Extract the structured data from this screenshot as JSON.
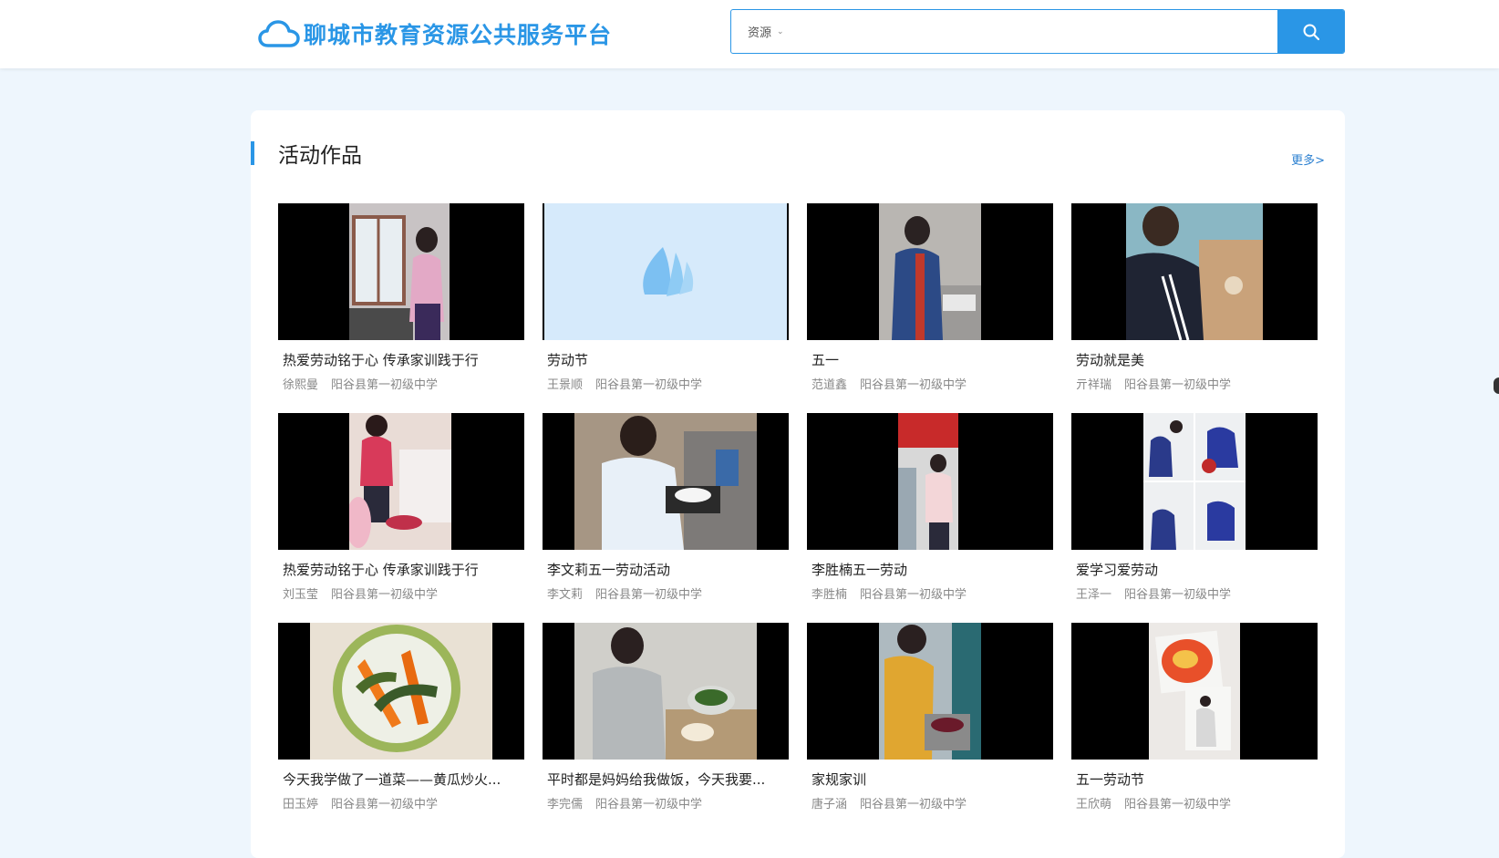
{
  "site": {
    "title": "聊城市教育资源公共服务平台",
    "brand_color": "#2a96e6"
  },
  "search": {
    "type_label": "资源",
    "placeholder": "",
    "icon": "search-icon"
  },
  "section": {
    "title": "活动作品",
    "more_label": "更多>"
  },
  "works": [
    {
      "title": "热爱劳动铭于心 传承家训践于行",
      "author": "徐熙曼",
      "school": "阳谷县第一初级中学",
      "thumb": "photo"
    },
    {
      "title": "劳动节",
      "author": "王景顺",
      "school": "阳谷县第一初级中学",
      "thumb": "placeholder"
    },
    {
      "title": "五一",
      "author": "范道鑫",
      "school": "阳谷县第一初级中学",
      "thumb": "photo"
    },
    {
      "title": "劳动就是美",
      "author": "亓祥瑞",
      "school": "阳谷县第一初级中学",
      "thumb": "photo"
    },
    {
      "title": "热爱劳动铭于心 传承家训践于行",
      "author": "刘玉莹",
      "school": "阳谷县第一初级中学",
      "thumb": "photo"
    },
    {
      "title": "李文莉五一劳动活动",
      "author": "李文莉",
      "school": "阳谷县第一初级中学",
      "thumb": "photo"
    },
    {
      "title": "李胜楠五一劳动",
      "author": "李胜楠",
      "school": "阳谷县第一初级中学",
      "thumb": "photo"
    },
    {
      "title": "爱学习爱劳动",
      "author": "王泽一",
      "school": "阳谷县第一初级中学",
      "thumb": "photo"
    },
    {
      "title": "今天我学做了一道菜——黄瓜炒火...",
      "author": "田玉婷",
      "school": "阳谷县第一初级中学",
      "thumb": "photo"
    },
    {
      "title": "平时都是妈妈给我做饭，今天我要...",
      "author": "李完儒",
      "school": "阳谷县第一初级中学",
      "thumb": "photo"
    },
    {
      "title": "家规家训",
      "author": "唐子涵",
      "school": "阳谷县第一初级中学",
      "thumb": "photo"
    },
    {
      "title": "五一劳动节",
      "author": "王欣萌",
      "school": "阳谷县第一初级中学",
      "thumb": "photo"
    }
  ]
}
